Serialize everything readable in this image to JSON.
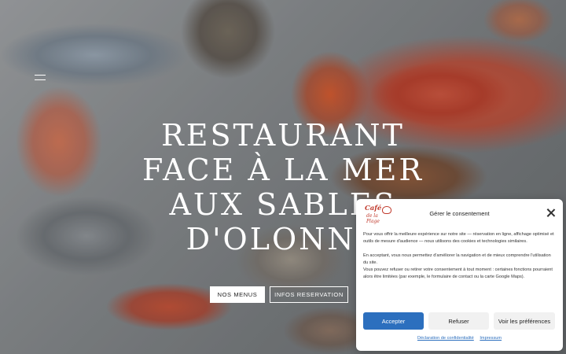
{
  "hero": {
    "title_lines": [
      "RESTAURANT",
      "FACE À LA MER",
      "AUX SABLES",
      "D'OLONNE"
    ],
    "buttons": {
      "menus": "NOS MENUS",
      "infos": "INFOS RESERVATION"
    }
  },
  "consent": {
    "logo": {
      "line1": "Café",
      "line2": "de la Plage"
    },
    "heading": "Gérer le consentement",
    "paragraphs": [
      "Pour vous offrir la meilleure expérience sur notre site — réservation en ligne, affichage optimisé et outils de mesure d'audience — nous utilisons des cookies et technologies similaires.",
      "En acceptant, vous nous permettez d'améliorer la navigation et de mieux comprendre l'utilisation du site.",
      "Vous pouvez refuser ou retirer votre consentement à tout moment : certaines fonctions pourraient alors être limitées (par exemple, le formulaire de contact ou la carte Google Maps)."
    ],
    "buttons": {
      "accept": "Accepter",
      "refuse": "Refuser",
      "preferences": "Voir les préférences"
    },
    "links": {
      "privacy": "Déclaration de confidentialité",
      "imprint": "Impressum"
    }
  },
  "colors": {
    "accent": "#2c6fbe",
    "logo": "#c0392b"
  },
  "icons": {
    "menu": "menu-icon",
    "close": "close-icon"
  }
}
